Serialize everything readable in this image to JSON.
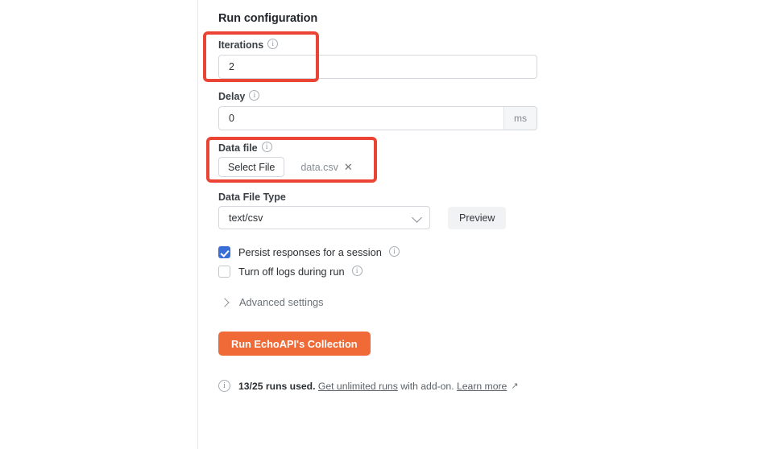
{
  "panel": {
    "title": "Run configuration"
  },
  "iterations": {
    "label": "Iterations",
    "info_icon": "info-circle-icon",
    "value": "2",
    "placeholder": ""
  },
  "delay": {
    "label": "Delay",
    "info_icon": "info-circle-icon",
    "value": "0",
    "placeholder": "",
    "unit": "ms"
  },
  "data_file": {
    "label": "Data file",
    "info_icon": "info-circle-icon",
    "select_button": "Select File",
    "file_name": "data.csv",
    "remove_icon": "✕"
  },
  "data_file_type": {
    "label": "Data File Type",
    "selected": "text/csv",
    "chevron_icon": "chevron-down-icon",
    "preview_button": "Preview"
  },
  "options": [
    {
      "name": "persist-responses",
      "label": "Persist responses for a session",
      "checked": true,
      "info_icon": "info-circle-icon"
    },
    {
      "name": "turn-off-logs",
      "label": "Turn off logs during run",
      "checked": false,
      "info_icon": "info-circle-icon"
    }
  ],
  "advanced": {
    "label": "Advanced settings",
    "chevron_icon": "chevron-right-icon",
    "expanded": false
  },
  "run": {
    "label": "Run EchoAPI's Collection"
  },
  "footer": {
    "info_icon": "info-circle-icon",
    "usage": "13/25 runs used.",
    "space1": " ",
    "link_unlimited": "Get unlimited runs",
    "middle": " with add-on. ",
    "link_learn": "Learn more",
    "external_arrow": "↗"
  },
  "colors": {
    "accent_orange": "#f06a38",
    "checkbox_blue": "#3a6fd8",
    "highlight_red": "#eb4334",
    "border_gray": "#d4d8dc",
    "muted_text": "#878d93"
  },
  "annotations": [
    {
      "name": "iterations-field",
      "color": "#eb4334"
    },
    {
      "name": "data-file-field",
      "color": "#eb4334"
    }
  ]
}
